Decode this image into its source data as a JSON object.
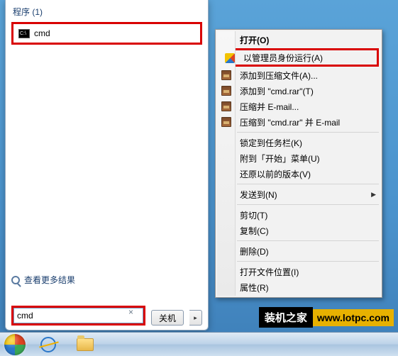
{
  "start_panel": {
    "section_header": "程序 (1)",
    "cmd_label": "cmd",
    "see_more": "查看更多结果",
    "search_value": "cmd",
    "shutdown_label": "关机"
  },
  "context_menu": {
    "open": "打开(O)",
    "run_admin": "以管理员身份运行(A)",
    "add_archive": "添加到压缩文件(A)...",
    "add_cmd_rar": "添加到 \"cmd.rar\"(T)",
    "compress_email": "压缩并 E-mail...",
    "compress_cmd_email": "压缩到 \"cmd.rar\" 并 E-mail",
    "pin_taskbar": "锁定到任务栏(K)",
    "pin_start": "附到「开始」菜单(U)",
    "restore_prev": "还原以前的版本(V)",
    "send_to": "发送到(N)",
    "cut": "剪切(T)",
    "copy": "复制(C)",
    "delete": "删除(D)",
    "open_location": "打开文件位置(I)",
    "properties": "属性(R)"
  },
  "watermark": {
    "brand": "装机之家",
    "url": "www.lotpc.com"
  }
}
